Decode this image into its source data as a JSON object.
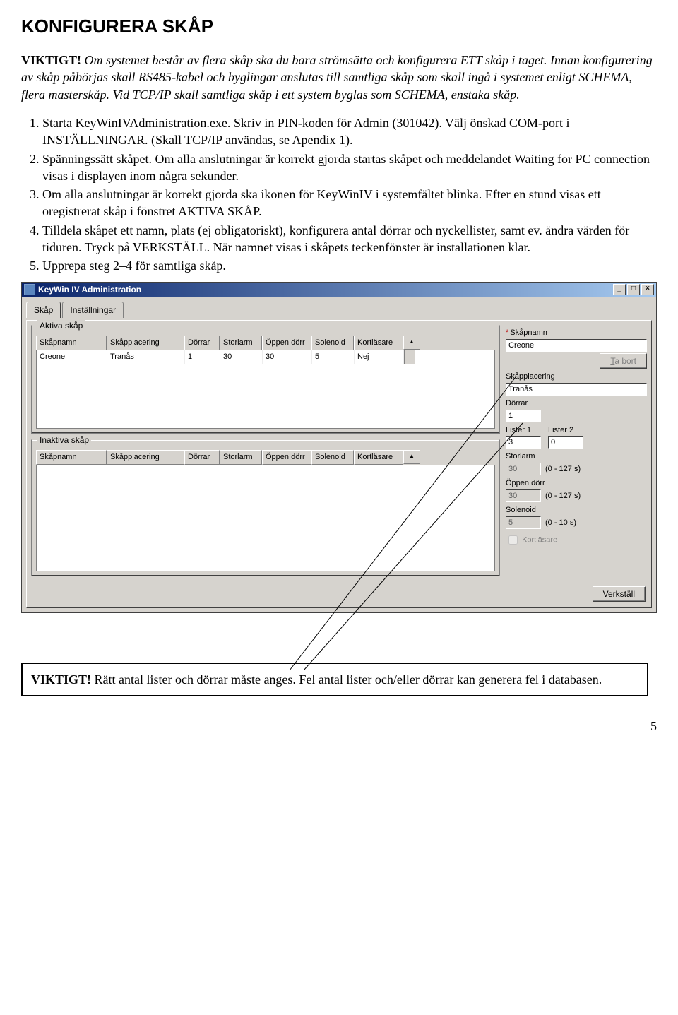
{
  "doc": {
    "title": "KONFIGURERA SKÅP",
    "intro_bold": "VIKTIGT!",
    "intro_rest": " Om systemet består av flera skåp ska du bara strömsätta och konfigurera ETT skåp i taget. Innan konfigurering av skåp påbörjas skall RS485-kabel och byglingar anslutas till samtliga skåp som skall ingå i systemet enligt SCHEMA, flera masterskåp. Vid TCP/IP skall samtliga skåp i ett system byglas som SCHEMA, enstaka skåp.",
    "steps": [
      "Starta KeyWinIVAdministration.exe. Skriv in PIN-koden för Admin (301042). Välj önskad COM-port i INSTÄLLNINGAR.\n(Skall TCP/IP användas, se Apendix 1).",
      "Spänningssätt skåpet. Om alla anslutningar är korrekt gjorda startas skåpet och meddelandet Waiting for PC connection visas i displayen inom några sekunder.",
      "Om alla anslutningar är korrekt gjorda ska ikonen för KeyWinIV i systemfältet blinka. Efter en stund visas ett oregistrerat skåp i fönstret AKTIVA SKÅP.",
      "Tilldela skåpet ett namn, plats (ej obligatoriskt), konfigurera antal dörrar och nyckellister, samt ev. ändra värden för tiduren. Tryck på VERKSTÄLL. När namnet visas i skåpets teckenfönster är installationen klar.",
      "Upprepa steg 2–4 för samtliga skåp."
    ],
    "note_bold": "VIKTIGT!",
    "note_rest": " Rätt antal lister och dörrar måste anges. Fel antal lister och/eller dörrar kan generera fel i databasen.",
    "page_number": "5"
  },
  "app": {
    "title": "KeyWin IV Administration",
    "tabs": {
      "skap": "Skåp",
      "installningar": "Inställningar"
    },
    "groups": {
      "aktiva": "Aktiva skåp",
      "inaktiva": "Inaktiva skåp"
    },
    "columns": [
      "Skåpnamn",
      "Skåpplacering",
      "Dörrar",
      "Storlarm",
      "Öppen dörr",
      "Solenoid",
      "Kortläsare"
    ],
    "row": {
      "name": "Creone",
      "place": "Tranås",
      "doors": "1",
      "alarm": "30",
      "open": "30",
      "sol": "5",
      "reader": "Nej"
    },
    "form": {
      "skapnamn_lbl": "Skåpnamn",
      "skapnamn_val": "Creone",
      "plats_lbl": "Skåpplacering",
      "plats_val": "Tranås",
      "dorrar_lbl": "Dörrar",
      "dorrar_val": "1",
      "lister1_lbl": "Lister 1",
      "lister1_val": "3",
      "lister2_lbl": "Lister 2",
      "lister2_val": "0",
      "storlarm_lbl": "Storlarm",
      "storlarm_val": "30",
      "storlarm_hint": "(0 - 127 s)",
      "open_lbl": "Öppen dörr",
      "open_val": "30",
      "open_hint": "(0 - 127 s)",
      "sol_lbl": "Solenoid",
      "sol_val": "5",
      "sol_hint": "(0 - 10 s)",
      "reader_lbl": "Kortläsare"
    },
    "buttons": {
      "tabort": "Ta bort",
      "verkstall": "Verkställ"
    }
  }
}
